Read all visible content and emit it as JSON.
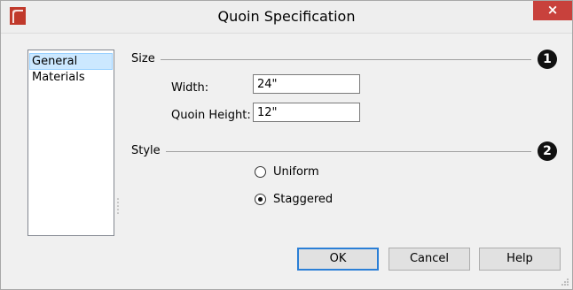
{
  "window": {
    "title": "Quoin Specification",
    "close_label": "×"
  },
  "nav": {
    "items": [
      {
        "label": "General",
        "selected": true
      },
      {
        "label": "Materials",
        "selected": false
      }
    ]
  },
  "size_section": {
    "label": "Size",
    "callout": "1",
    "width_label": "Width:",
    "width_value": "24\"",
    "height_label": "Quoin Height:",
    "height_value": "12\""
  },
  "style_section": {
    "label": "Style",
    "callout": "2",
    "options": [
      {
        "label": "Uniform",
        "checked": false
      },
      {
        "label": "Staggered",
        "checked": true
      }
    ]
  },
  "buttons": {
    "ok": "OK",
    "cancel": "Cancel",
    "help": "Help"
  },
  "colors": {
    "close_bg": "#c8413c",
    "selection_bg": "#cce8ff",
    "app_icon": "#c0392b"
  }
}
